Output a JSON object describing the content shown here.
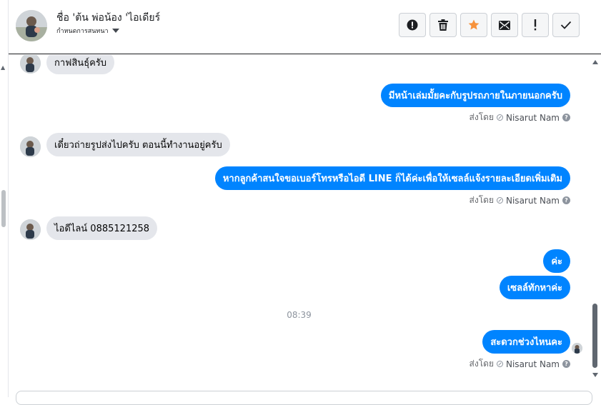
{
  "header": {
    "name": "ชื่อ 'ต้น พ่อน้อง 'ไอเดียร์",
    "subtitle": "กำหนดการสนทนา",
    "actions": [
      {
        "icon": "alert-circle-icon"
      },
      {
        "icon": "trash-icon"
      },
      {
        "icon": "star-icon"
      },
      {
        "icon": "envelope-icon"
      },
      {
        "icon": "exclamation-icon"
      },
      {
        "icon": "check-icon"
      }
    ]
  },
  "messages": [
    {
      "direction": "in",
      "text": "กาฟสินธุ์ครับ"
    },
    {
      "direction": "out",
      "text": "มีหน้าเล่มมั้ยคะกับรูปรถภายในภายนอกครับ",
      "sent_by_prefix": "ส่งโดย",
      "sent_by_name": "Nisarut Nam"
    },
    {
      "direction": "in",
      "text": "เดี๋ยวถ่ายรูปส่งไปครับ ตอนนี้ทำงานอยู่ครับ"
    },
    {
      "direction": "out",
      "text": "หากลูกค้าสนใจขอเบอร์โทรหรือไอดี LINE ก็ได้ค่ะเพื่อให้เซลล์แจ้งรายละเอียดเพิ่มเติม",
      "sent_by_prefix": "ส่งโดย",
      "sent_by_name": "Nisarut Nam"
    },
    {
      "direction": "in",
      "text": "ไอดีไลน์ 0885121258"
    },
    {
      "direction": "out",
      "text": "ค่ะ"
    },
    {
      "direction": "out",
      "text": "เซลล์ทักหาค่ะ"
    },
    {
      "direction": "out",
      "text": "สะดวกช่วงไหนคะ",
      "sent_by_prefix": "ส่งโดย",
      "sent_by_name": "Nisarut Nam"
    }
  ],
  "timestamp": "08:39",
  "colors": {
    "outgoing_bubble": "#0084ff",
    "incoming_bubble": "#e4e6eb",
    "star": "#f7923b"
  }
}
